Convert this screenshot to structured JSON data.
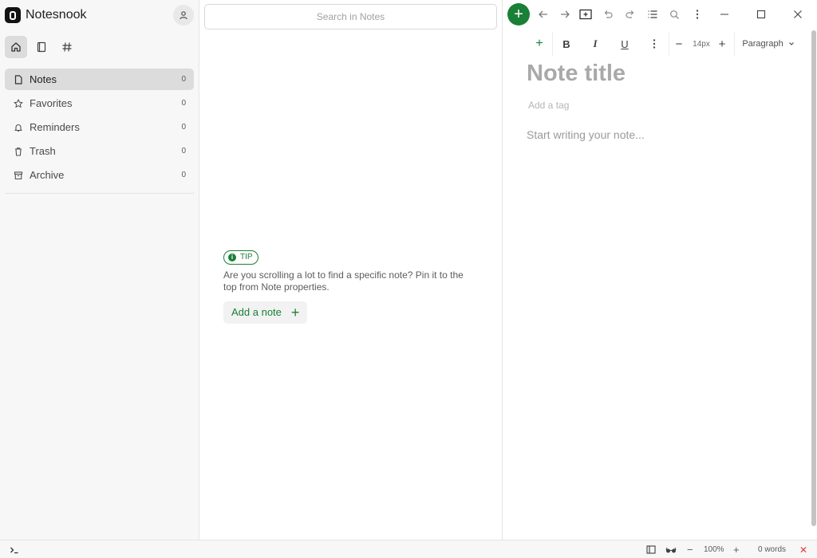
{
  "app": {
    "name": "Notesnook"
  },
  "sidebar": {
    "view_tabs": [
      {
        "name": "home",
        "icon": "home-icon",
        "active": true
      },
      {
        "name": "notebooks",
        "icon": "notebook-icon",
        "active": false
      },
      {
        "name": "tags",
        "icon": "hash-icon",
        "active": false
      }
    ],
    "items": [
      {
        "label": "Notes",
        "count": "0",
        "icon": "note-icon"
      },
      {
        "label": "Favorites",
        "count": "0",
        "icon": "star-icon"
      },
      {
        "label": "Reminders",
        "count": "0",
        "icon": "bell-icon"
      },
      {
        "label": "Trash",
        "count": "0",
        "icon": "trash-icon"
      },
      {
        "label": "Archive",
        "count": "0",
        "icon": "archive-icon"
      }
    ]
  },
  "list": {
    "search_placeholder": "Search in Notes",
    "tip_label": "TIP",
    "tip_text": "Are you scrolling a lot to find a specific note? Pin it to the top from Note properties.",
    "add_note_label": "Add a note"
  },
  "editor": {
    "title_placeholder": "Note title",
    "tag_placeholder": "Add a tag",
    "body_placeholder": "Start writing your note...",
    "font_size": "14px",
    "block_type": "Paragraph",
    "format_buttons": {
      "bold": "B",
      "italic": "I",
      "underline": "U"
    }
  },
  "statusbar": {
    "zoom": "100%",
    "word_count": "0 words"
  },
  "colors": {
    "accent": "#1a7f37",
    "sidebar_bg": "#f7f7f7",
    "danger": "#e53935"
  }
}
